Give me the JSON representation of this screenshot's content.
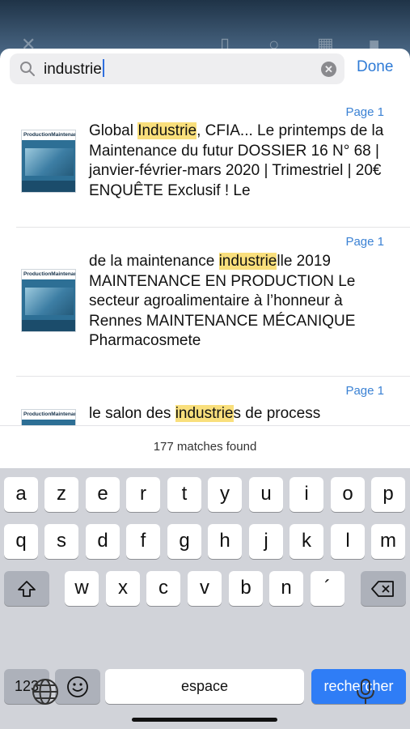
{
  "search": {
    "query": "industrie",
    "done_label": "Done"
  },
  "results": [
    {
      "page": "Page 1",
      "pre": "Global ",
      "hit": "Industrie",
      "post": ", CFIA... Le printemps de la Maintenance du futur DOSSIER 16 N° 68 | janvier-février-mars 2020 | Trimestriel | 20€ ENQUÊTE Exclusif ! Le",
      "mast": "ProductionMaintenance"
    },
    {
      "page": "Page 1",
      "pre": "de la maintenance ",
      "hit": "industrie",
      "post": "lle 2019 MAINTENANCE EN PRODUCTION Le secteur agroalimentaire à l’honneur à Rennes MAINTENANCE MÉCANIQUE Pharmacosmete",
      "mast": "ProductionMaintenance"
    },
    {
      "page": "Page 1",
      "pre": "le salon des ",
      "hit": "industrie",
      "post": "s de process",
      "mast": "ProductionMaintenance"
    }
  ],
  "matches_label": "177 matches found",
  "keyboard": {
    "row1": [
      "a",
      "z",
      "e",
      "r",
      "t",
      "y",
      "u",
      "i",
      "o",
      "p"
    ],
    "row2": [
      "q",
      "s",
      "d",
      "f",
      "g",
      "h",
      "j",
      "k",
      "l",
      "m"
    ],
    "row3": [
      "w",
      "x",
      "c",
      "v",
      "b",
      "n",
      "´"
    ],
    "numbers_label": "123",
    "space_label": "espace",
    "search_label": "rechercher"
  },
  "icons": [
    "search-icon",
    "clear-icon",
    "shift-icon",
    "delete-icon",
    "emoji-icon",
    "globe-icon",
    "microphone-icon"
  ],
  "colors": {
    "accent": "#2f7bd6",
    "highlight": "#f9df7c",
    "key_blue": "#2f7df6"
  }
}
